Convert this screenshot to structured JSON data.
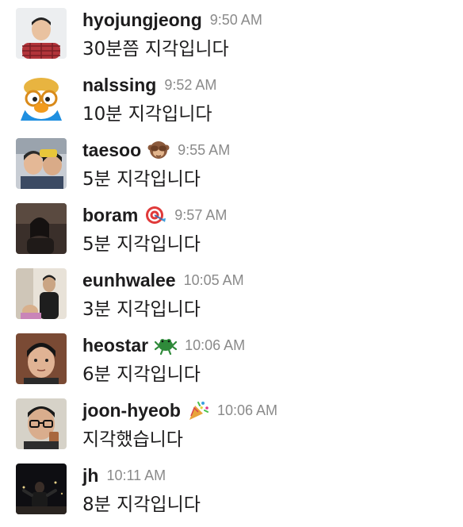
{
  "messages": [
    {
      "user": "hyojungjeong",
      "time": "9:50 AM",
      "text": "30분쯤 지각입니다",
      "avatar_icon": "person-avatar-red-plaid"
    },
    {
      "user": "nalssing",
      "time": "9:52 AM",
      "text": "10분 지각입니다",
      "avatar_icon": "penguin-cartoon-avatar"
    },
    {
      "user": "taesoo",
      "time": "9:55 AM",
      "text": "5분 지각입니다",
      "avatar_icon": "selfie-avatar",
      "status_icon": "see-no-evil-monkey-icon"
    },
    {
      "user": "boram",
      "time": "9:57 AM",
      "text": "5분 지각입니다",
      "avatar_icon": "dark-photo-avatar",
      "status_icon": "target-icon"
    },
    {
      "user": "eunhwalee",
      "time": "10:05 AM",
      "text": "3분 지각입니다",
      "avatar_icon": "indoor-photo-avatar"
    },
    {
      "user": "heostar",
      "time": "10:06 AM",
      "text": "6분 지각입니다",
      "avatar_icon": "face-photo-avatar",
      "status_icon": "green-creature-icon"
    },
    {
      "user": "joon-hyeob",
      "time": "10:06 AM",
      "text": "지각했습니다",
      "avatar_icon": "glasses-photo-avatar",
      "status_icon": "party-popper-icon"
    },
    {
      "user": "jh",
      "time": "10:11 AM",
      "text": "8분 지각입니다",
      "avatar_icon": "night-photo-avatar"
    }
  ]
}
